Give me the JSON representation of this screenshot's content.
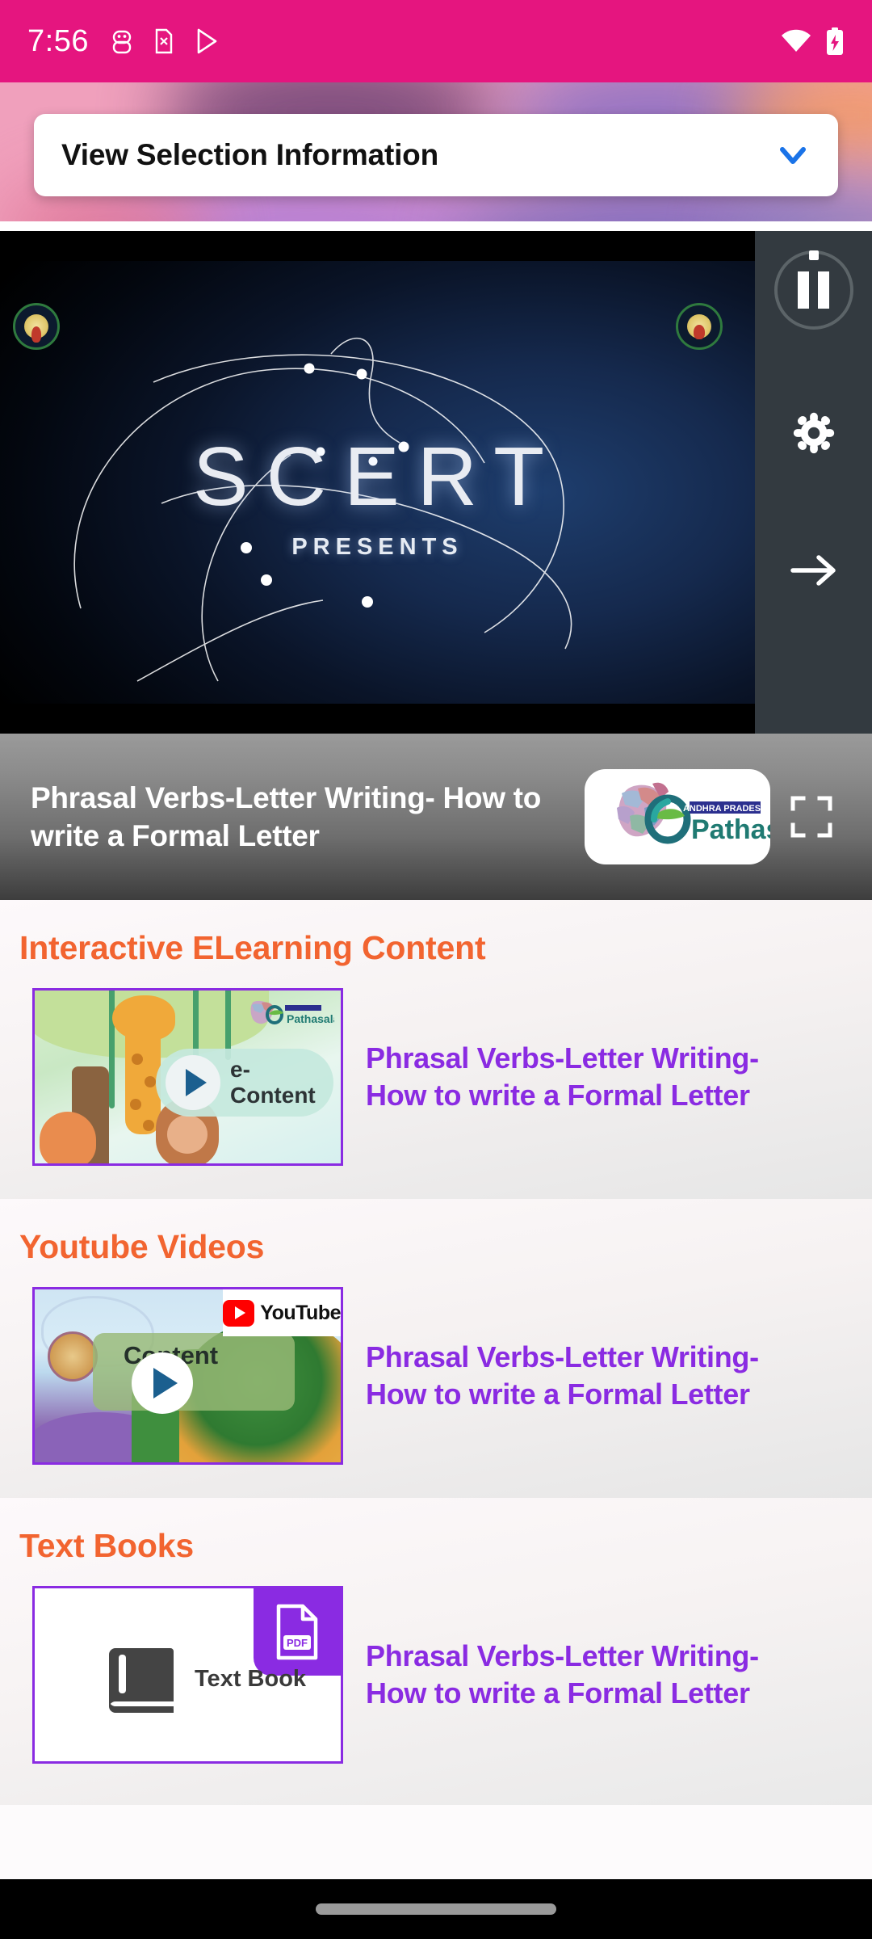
{
  "status_bar": {
    "time": "7:56",
    "background_color": "#E5157F",
    "left_icons": [
      "android-debug-icon",
      "sim-card-alert-icon",
      "play-store-icon"
    ],
    "right_icons": [
      "wifi-icon",
      "battery-charging-icon"
    ]
  },
  "header": {
    "dropdown_label": "View Selection Information",
    "chevron_icon": "chevron-down-icon",
    "chevron_color": "#1A73E8"
  },
  "player": {
    "splash_title": "SCERT",
    "splash_subtitle": "PRESENTS",
    "left_emblem": "ap-government-emblem",
    "right_emblem": "scert-emblem",
    "controls": {
      "pause_icon": "pause-icon",
      "settings_icon": "gear-icon",
      "next_icon": "arrow-right-icon"
    }
  },
  "title_bar": {
    "title": "Phrasal Verbs-Letter Writing- How to write a Formal Letter",
    "logo_brand": "Pathasala",
    "logo_superscript": "ANDHRA PRADESH",
    "fullscreen_icon": "fullscreen-icon"
  },
  "sections": [
    {
      "heading": "Interactive ELearning Content",
      "heading_color": "#F26430",
      "item_title": "Phrasal Verbs-Letter Writing- How to write a Formal Letter",
      "item_title_color": "#8A2BE2",
      "thumb_label": "e-Content",
      "thumb_badge": "",
      "thumb_logo": "pathasala-logo",
      "play_icon": "play-icon"
    },
    {
      "heading": "Youtube Videos",
      "heading_color": "#F26430",
      "item_title": "Phrasal Verbs-Letter Writing- How to write a Formal Letter",
      "item_title_color": "#8A2BE2",
      "thumb_label": "Content",
      "thumb_badge": "YouTube",
      "thumb_logo": "youtube-logo",
      "play_icon": "play-icon"
    },
    {
      "heading": "Text Books",
      "heading_color": "#F26430",
      "item_title": "Phrasal Verbs-Letter Writing- How to write a Formal Letter",
      "item_title_color": "#8A2BE2",
      "thumb_label": "Text Book",
      "thumb_badge": "PDF",
      "thumb_logo": "book-icon",
      "play_icon": ""
    }
  ],
  "nav_bar": {
    "gesture_pill": "home-gesture-pill"
  }
}
